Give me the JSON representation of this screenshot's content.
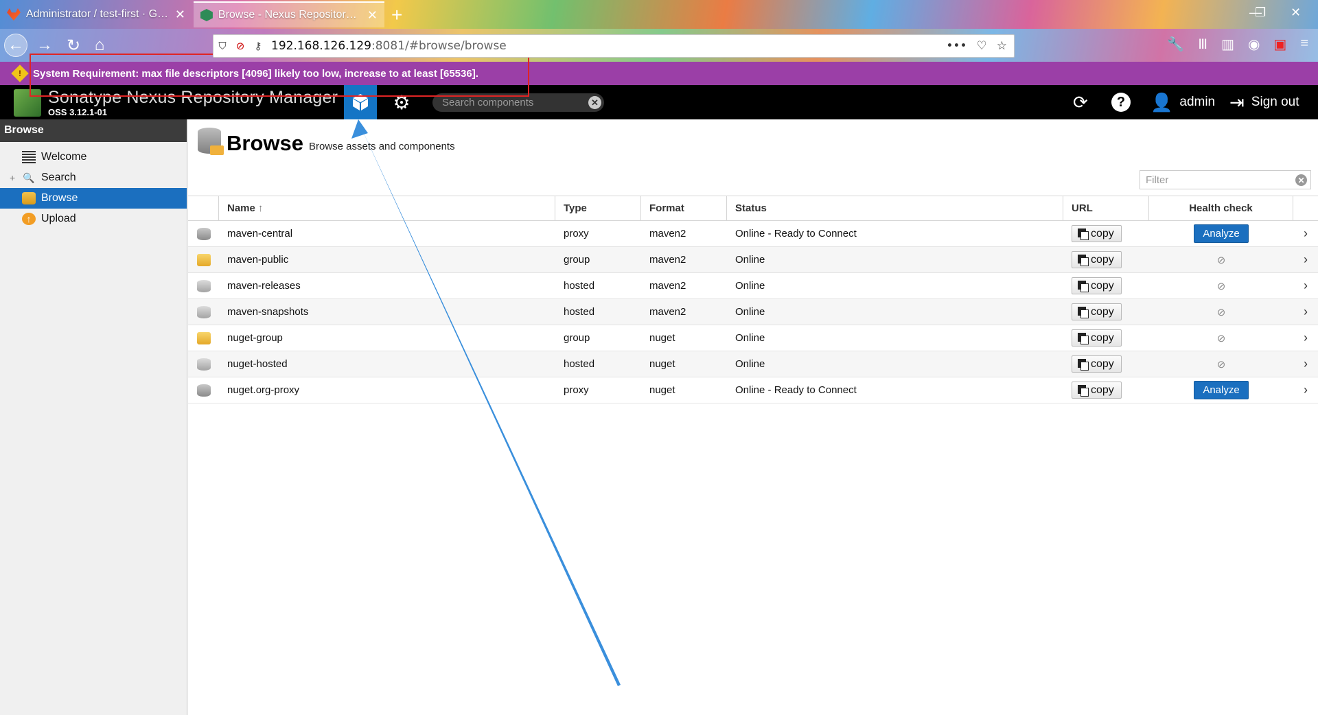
{
  "browser": {
    "tabs": [
      {
        "label": "Administrator / test-first · GitLab",
        "active": false
      },
      {
        "label": "Browse - Nexus Repository Manager",
        "active": true
      }
    ],
    "url_host": "192.168.126.129",
    "url_rest": ":8081/#browse/browse"
  },
  "system_warning": "System Requirement: max file descriptors [4096] likely too low, increase to at least [65536].",
  "nexus": {
    "app_title": "Sonatype Nexus Repository Manager",
    "version": "OSS 3.12.1-01",
    "search_placeholder": "Search components",
    "user": "admin",
    "sign_out": "Sign out"
  },
  "leftnav": {
    "title": "Browse",
    "items": [
      {
        "label": "Welcome",
        "icon": "list-icon"
      },
      {
        "label": "Search",
        "icon": "search-icon"
      },
      {
        "label": "Browse",
        "icon": "database-icon"
      },
      {
        "label": "Upload",
        "icon": "upload-icon"
      }
    ]
  },
  "page": {
    "title": "Browse",
    "subtitle": "Browse assets and components",
    "filter_placeholder": "Filter"
  },
  "grid": {
    "columns": [
      "Name",
      "Type",
      "Format",
      "Status",
      "URL",
      "Health check"
    ],
    "copy_label": "copy",
    "analyze_label": "Analyze",
    "rows": [
      {
        "name": "maven-central",
        "type": "proxy",
        "format": "maven2",
        "status": "Online - Ready to Connect"
      },
      {
        "name": "maven-public",
        "type": "group",
        "format": "maven2",
        "status": "Online"
      },
      {
        "name": "maven-releases",
        "type": "hosted",
        "format": "maven2",
        "status": "Online"
      },
      {
        "name": "maven-snapshots",
        "type": "hosted",
        "format": "maven2",
        "status": "Online"
      },
      {
        "name": "nuget-group",
        "type": "group",
        "format": "nuget",
        "status": "Online"
      },
      {
        "name": "nuget-hosted",
        "type": "hosted",
        "format": "nuget",
        "status": "Online"
      },
      {
        "name": "nuget.org-proxy",
        "type": "proxy",
        "format": "nuget",
        "status": "Online - Ready to Connect"
      }
    ]
  },
  "colors": {
    "warning_bar": "#9b3fa7",
    "selected": "#1b6fbf",
    "annotation_rect": "#e02424",
    "annotation_arrow": "#3a8fdc"
  }
}
